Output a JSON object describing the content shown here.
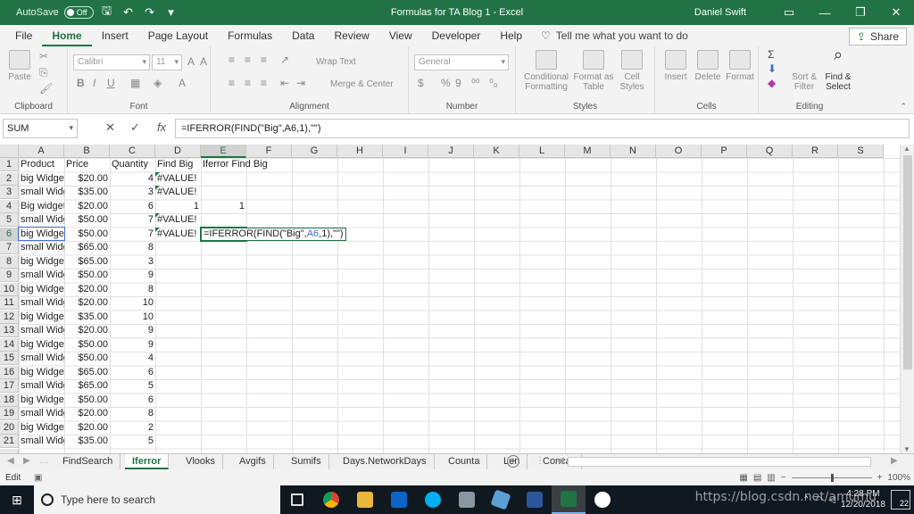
{
  "titlebar": {
    "autosave_label": "AutoSave",
    "autosave_state": "Off",
    "title": "Formulas for TA Blog 1  -  Excel",
    "user": "Daniel Swift"
  },
  "ribbon_tabs": [
    "File",
    "Home",
    "Insert",
    "Page Layout",
    "Formulas",
    "Data",
    "Review",
    "View",
    "Developer",
    "Help"
  ],
  "active_tab": "Home",
  "tell_me": "Tell me what you want to do",
  "share_label": "Share",
  "ribbon": {
    "clipboard": {
      "label": "Clipboard",
      "paste": "Paste"
    },
    "font": {
      "label": "Font",
      "font_name": "Calibri",
      "font_size": "11"
    },
    "alignment": {
      "label": "Alignment",
      "wrap": "Wrap Text",
      "merge": "Merge & Center"
    },
    "number": {
      "label": "Number",
      "format": "General"
    },
    "styles": {
      "label": "Styles",
      "cond": "Conditional Formatting",
      "table": "Format as Table",
      "cell": "Cell Styles"
    },
    "cells": {
      "label": "Cells",
      "insert": "Insert",
      "delete": "Delete",
      "format": "Format"
    },
    "editing": {
      "label": "Editing",
      "sort": "Sort & Filter",
      "find": "Find & Select"
    }
  },
  "formula_bar": {
    "name_box": "SUM",
    "formula": "=IFERROR(FIND(\"Big\",A6,1),\"\")"
  },
  "columns": [
    "A",
    "B",
    "C",
    "D",
    "E",
    "F",
    "G",
    "H",
    "I",
    "J",
    "K",
    "L",
    "M",
    "N",
    "O",
    "P",
    "Q",
    "R",
    "S"
  ],
  "rows": [
    [
      "Product",
      "Price",
      "Quantity",
      "Find Big",
      "Iferror Find Big"
    ],
    [
      "big Widget",
      "$20.00",
      "4",
      "#VALUE!",
      ""
    ],
    [
      "small Widget",
      "$35.00",
      "3",
      "#VALUE!",
      ""
    ],
    [
      "Big widget",
      "$20.00",
      "6",
      "1",
      "1"
    ],
    [
      "small Widget",
      "$50.00",
      "7",
      "#VALUE!",
      ""
    ],
    [
      "big Widget",
      "$50.00",
      "7",
      "#VALUE!",
      ""
    ],
    [
      "small Widget",
      "$65.00",
      "8",
      "",
      ""
    ],
    [
      "big Widget",
      "$65.00",
      "3",
      "",
      ""
    ],
    [
      "small Widget",
      "$50.00",
      "9",
      "",
      ""
    ],
    [
      "big Widget",
      "$20.00",
      "8",
      "",
      ""
    ],
    [
      "small Widget",
      "$20.00",
      "10",
      "",
      ""
    ],
    [
      "big Widget",
      "$35.00",
      "10",
      "",
      ""
    ],
    [
      "small Widget",
      "$20.00",
      "9",
      "",
      ""
    ],
    [
      "big Widget",
      "$50.00",
      "9",
      "",
      ""
    ],
    [
      "small Widget",
      "$50.00",
      "4",
      "",
      ""
    ],
    [
      "big Widget",
      "$65.00",
      "6",
      "",
      ""
    ],
    [
      "small Widget",
      "$65.00",
      "5",
      "",
      ""
    ],
    [
      "big Widget",
      "$50.00",
      "6",
      "",
      ""
    ],
    [
      "small Widget",
      "$20.00",
      "8",
      "",
      ""
    ],
    [
      "big Widget",
      "$20.00",
      "2",
      "",
      ""
    ],
    [
      "small Widget",
      "$35.00",
      "5",
      "",
      ""
    ]
  ],
  "editing_cell": {
    "prefix": "=IFERROR(FIND(\"Big\",",
    "ref": "A6",
    "suffix": ",1),\"\")"
  },
  "sheets": [
    "FindSearch",
    "Iferror",
    "Vlooks",
    "Avgifs",
    "Sumifs",
    "Days.NetworkDays",
    "Counta",
    "Len",
    "Concat"
  ],
  "active_sheet": "Iferror",
  "status": {
    "mode": "Edit",
    "zoom": "100%"
  },
  "taskbar": {
    "search_placeholder": "Type here to search",
    "time": "4:28 PM",
    "date": "12/20/2018",
    "notifications": "22"
  },
  "watermark": "https://blog.csdn.net/amumu",
  "colors": {
    "excel_green": "#217346",
    "ref_blue": "#3c6fd6"
  }
}
